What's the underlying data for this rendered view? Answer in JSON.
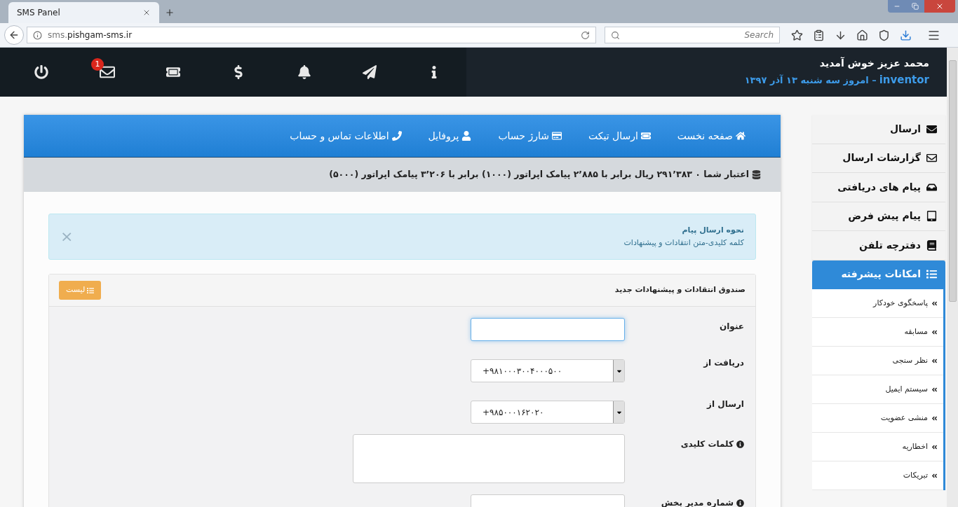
{
  "browser": {
    "tab_title": "SMS Panel",
    "url_host": "sms.",
    "url_domain": "pishgam-sms.ir",
    "search_placeholder": "Search"
  },
  "header": {
    "greeting": "محمد عزیز خوش آمدید",
    "username": "inventor",
    "date": "– امروز سه شنبه ۱۳ آذر ۱۳۹۷",
    "mail_badge": "1"
  },
  "nav": [
    {
      "kind": "home",
      "label": "صفحه نخست"
    },
    {
      "kind": "ticket",
      "label": "ارسال تیکت"
    },
    {
      "kind": "card",
      "label": "شارژ حساب"
    },
    {
      "kind": "user",
      "label": "پروفایل"
    },
    {
      "kind": "phone",
      "label": "اطلاعات تماس و حساب"
    }
  ],
  "credit": "اعتبار شما ۰ ۲۹۱٬۳۸۳ ریال برابر با ۲٬۸۸۵ پیامک اپراتور (۱۰۰۰) برابر با ۳٬۲۰۶ پیامک اپراتور (۵۰۰۰)",
  "alert": {
    "title": "نحوه ارسال پیام",
    "body": "کلمه کلیدی-متن انتقادات و پیشنهادات",
    "close": "×"
  },
  "panel": {
    "title": "صندوق انتقادات و پیشنهادات جدید",
    "list_button": "لیست"
  },
  "fields": [
    {
      "kind": "text",
      "label": "عنوان",
      "info": false,
      "focused": true
    },
    {
      "kind": "select",
      "label": "دریافت از",
      "info": false,
      "value": "+۹۸۱۰۰۰۳۰۰۴۰۰۰۵۰۰"
    },
    {
      "kind": "select",
      "label": "ارسال از",
      "info": false,
      "value": "+۹۸۵۰۰۰۱۶۲۰۲۰"
    },
    {
      "kind": "textarea",
      "label": "کلمات کلیدی",
      "info": true
    },
    {
      "kind": "text",
      "label": "شماره مدیر بخش",
      "info": true,
      "focused": false
    }
  ],
  "sidebar": [
    {
      "kind": "envelope",
      "label": "ارسال",
      "selected": false
    },
    {
      "kind": "envelope-outline",
      "label": "گزارشات ارسال",
      "selected": false
    },
    {
      "kind": "inbox",
      "label": "پیام های دریافتی",
      "selected": false
    },
    {
      "kind": "tablet",
      "label": "پیام پیش فرض",
      "selected": false
    },
    {
      "kind": "book",
      "label": "دفترچه تلفن",
      "selected": false
    },
    {
      "kind": "list",
      "label": "امکانات پیشرفته",
      "selected": true
    }
  ],
  "submenu": [
    "پاسخگوی خودکار",
    "مسابقه",
    "نظر سنجی",
    "سیستم ایمیل",
    "منشی عضویت",
    "اخطاریه",
    "تبریکات"
  ]
}
